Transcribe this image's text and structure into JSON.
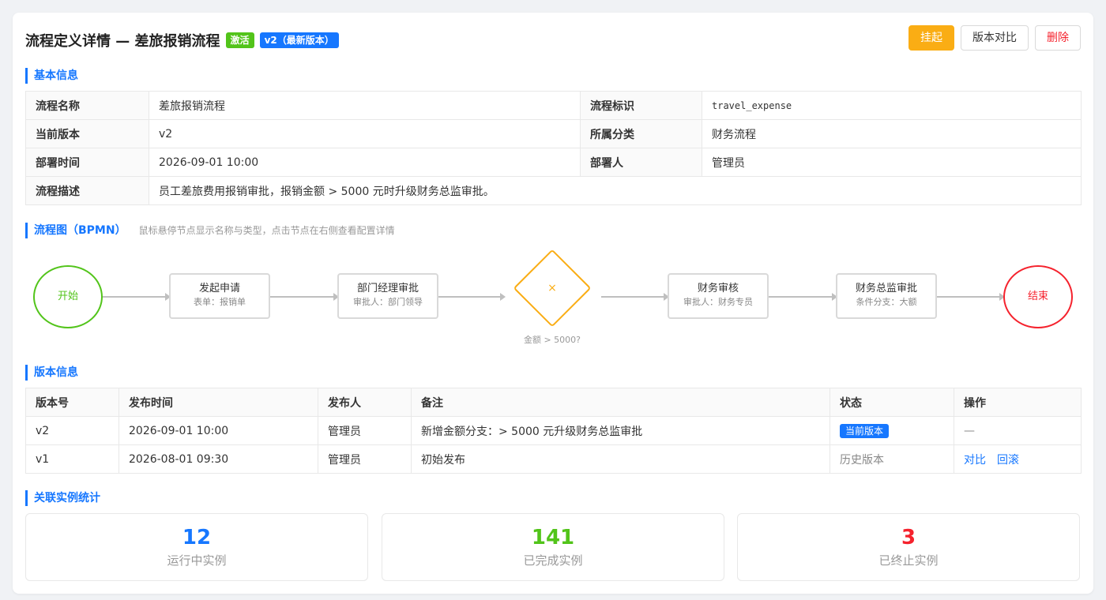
{
  "header": {
    "title": "流程定义详情 — 差旅报销流程",
    "tag_active": "激活",
    "tag_version": "v2（最新版本）",
    "btn_suspend": "挂起",
    "btn_compare": "版本对比",
    "btn_delete": "删除"
  },
  "basic": {
    "heading": "基本信息",
    "name_label": "流程名称",
    "name_value": "差旅报销流程",
    "key_label": "流程标识",
    "key_value": "travel_expense",
    "version_label": "当前版本",
    "version_value": "v2",
    "category_label": "所属分类",
    "category_value": "财务流程",
    "deploy_time_label": "部署时间",
    "deploy_time_value": "2026-09-01 10:00",
    "deployer_label": "部署人",
    "deployer_value": "管理员",
    "desc_label": "流程描述",
    "desc_value": "员工差旅费用报销审批，报销金额 > 5000 元时升级财务总监审批。"
  },
  "diagram": {
    "heading": "流程图（BPMN）",
    "hint": "鼠标悬停节点显示名称与类型，点击节点在右侧查看配置详情",
    "start": "开始",
    "end": "结束",
    "gateway_symbol": "×",
    "gateway_label": "金额 > 5000?",
    "nodes": [
      {
        "title": "发起申请",
        "sub": "表单：报销单"
      },
      {
        "title": "部门经理审批",
        "sub": "审批人：部门领导"
      },
      {
        "title": "财务审核",
        "sub": "审批人：财务专员"
      },
      {
        "title": "财务总监审批",
        "sub": "条件分支：大额"
      }
    ]
  },
  "versions": {
    "heading": "版本信息",
    "columns": [
      "版本号",
      "发布时间",
      "发布人",
      "备注",
      "状态",
      "操作"
    ],
    "rows": [
      {
        "version": "v2",
        "time": "2026-09-01 10:00",
        "publisher": "管理员",
        "note": "新增金额分支：> 5000 元升级财务总监审批",
        "status": "当前版本",
        "op": "—"
      },
      {
        "version": "v1",
        "time": "2026-08-01 09:30",
        "publisher": "管理员",
        "note": "初始发布",
        "status": "历史版本",
        "op_compare": "对比",
        "op_rollback": "回滚"
      }
    ]
  },
  "stats": {
    "heading": "关联实例统计",
    "running": {
      "value": "12",
      "label": "运行中实例",
      "color": "#1677ff"
    },
    "completed": {
      "value": "141",
      "label": "已完成实例",
      "color": "#52c41a"
    },
    "terminated": {
      "value": "3",
      "label": "已终止实例",
      "color": "#f5222d"
    }
  }
}
